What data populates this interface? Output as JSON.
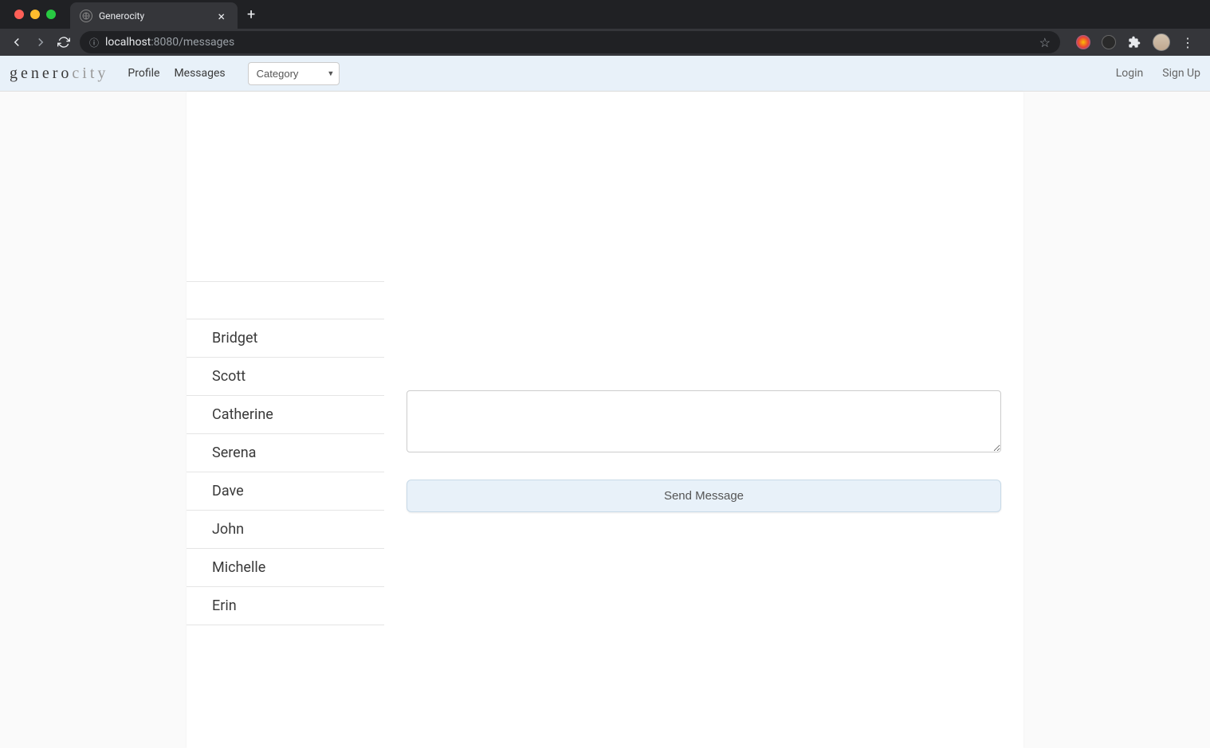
{
  "browser": {
    "tab_title": "Generocity",
    "url_host": "localhost",
    "url_port_path": ":8080/messages"
  },
  "nav": {
    "logo_main": "genero",
    "logo_light": "city",
    "links": [
      "Profile",
      "Messages"
    ],
    "category_label": "Category",
    "login": "Login",
    "signup": "Sign Up"
  },
  "contacts": [
    "",
    "Bridget",
    "Scott",
    "Catherine",
    "Serena",
    "Dave",
    "John",
    "Michelle",
    "Erin"
  ],
  "message": {
    "textarea_value": "",
    "send_button": "Send Message"
  }
}
